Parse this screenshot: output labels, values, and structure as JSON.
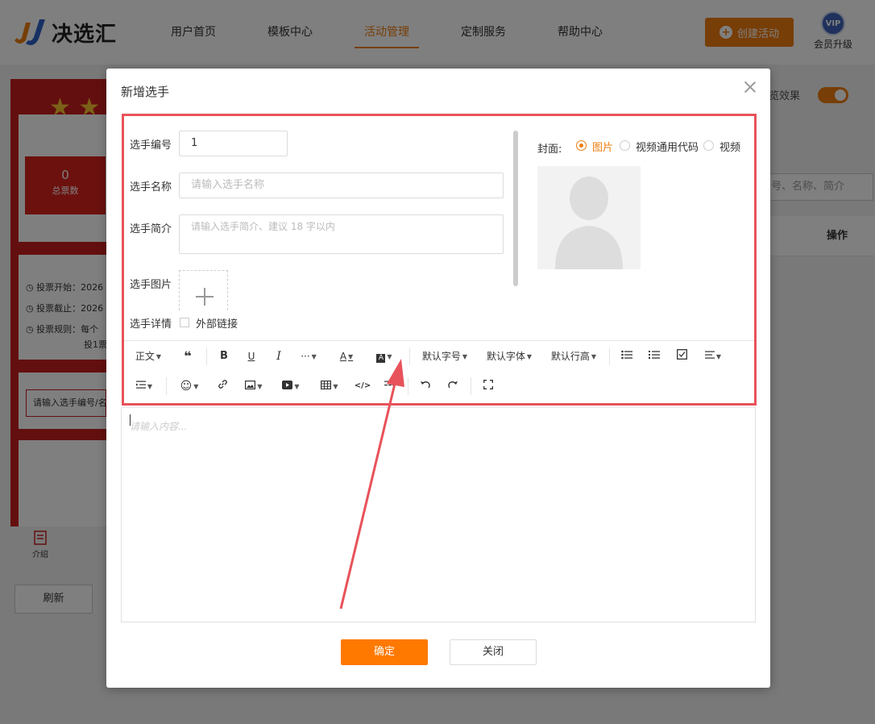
{
  "app": {
    "logo_text": "决选汇",
    "nav": [
      "用户首页",
      "模板中心",
      "活动管理",
      "定制服务",
      "帮助中心"
    ],
    "active_nav_index": 2,
    "create_button": "创建活动",
    "vip_label": "会员升级",
    "vip_badge": "VIP",
    "accent_color": "#ef7d0f"
  },
  "background": {
    "stat_value": "0",
    "stat_label": "总票数",
    "vote_start": "投票开始：2026",
    "vote_end": "投票截止：2026",
    "vote_rule": "投票规则：每个",
    "vote_rule_cont": "投1票",
    "search_placeholder": "请输入选手编号/名",
    "intro_tab": "介绍",
    "refresh_button": "刷新",
    "preview_label": "览效果",
    "right_search_placeholder": "号、名称、简介",
    "op_header": "操作"
  },
  "modal": {
    "title": "新增选手",
    "fields": {
      "number_label": "选手编号",
      "number_value": "1",
      "name_label": "选手名称",
      "name_placeholder": "请输入选手名称",
      "intro_label": "选手简介",
      "intro_placeholder": "请输入选手简介、建议 18 字以内",
      "image_label": "选手图片",
      "detail_label": "选手详情",
      "external_link_label": "外部链接"
    },
    "cover": {
      "label": "封面:",
      "options": [
        "图片",
        "视频通用代码",
        "视频"
      ],
      "selected": "图片"
    },
    "toolbar": {
      "paragraph": "正文",
      "font_size": "默认字号",
      "font_family": "默认字体",
      "line_height": "默认行高",
      "more": "···"
    },
    "editor_placeholder": "请输入内容...",
    "confirm_button": "确定",
    "close_button": "关闭"
  },
  "annotation": {
    "highlight_color": "#e8525a"
  }
}
